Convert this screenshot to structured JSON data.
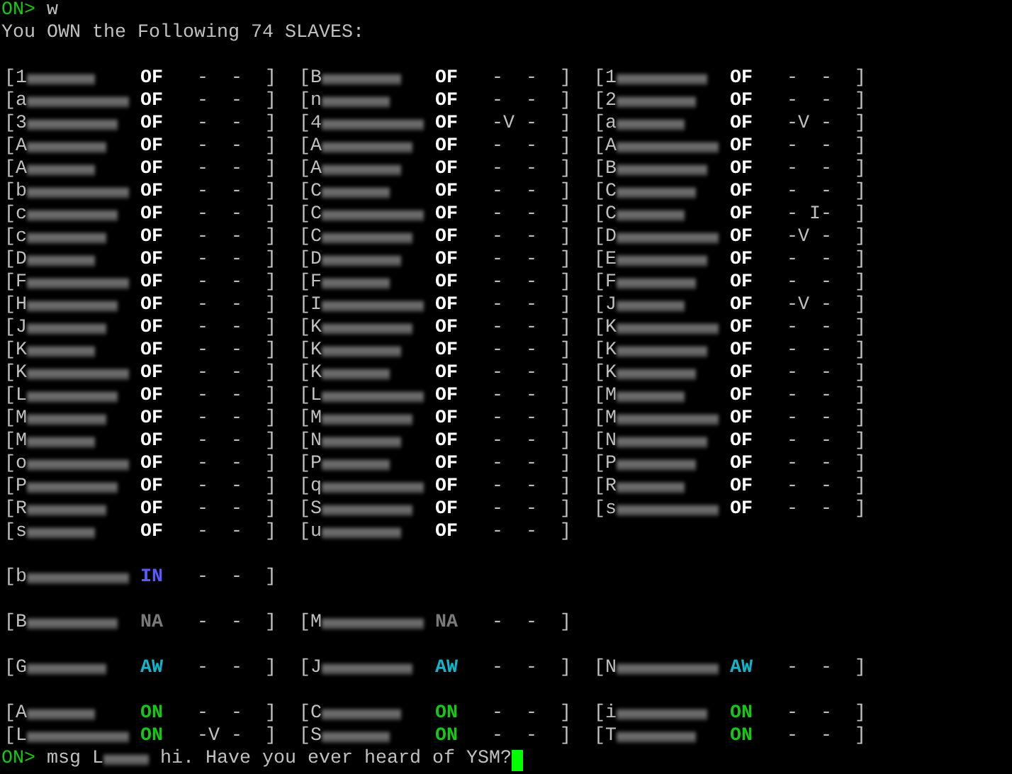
{
  "lines": [
    {
      "prompt": "ON>",
      "command": "w"
    },
    {
      "text": "You OWN the Following 74 SLAVES:"
    }
  ],
  "groups": [
    {
      "columns": [
        [
          {
            "name": "[1",
            "status": "OF",
            "color": "#ffffff",
            "tail": "-  -  ]"
          },
          {
            "name": "[a",
            "status": "OF",
            "color": "#ffffff",
            "tail": "-  -  ]"
          },
          {
            "name": "[3",
            "status": "OF",
            "color": "#ffffff",
            "tail": "-  -  ]"
          },
          {
            "name": "[A",
            "status": "OF",
            "color": "#ffffff",
            "tail": "-  -  ]"
          },
          {
            "name": "[A",
            "status": "OF",
            "color": "#ffffff",
            "tail": "-  -  ]"
          },
          {
            "name": "[b",
            "status": "OF",
            "color": "#ffffff",
            "tail": "-  -  ]"
          },
          {
            "name": "[c",
            "status": "OF",
            "color": "#ffffff",
            "tail": "-  -  ]"
          },
          {
            "name": "[c",
            "status": "OF",
            "color": "#ffffff",
            "tail": "-  -  ]"
          },
          {
            "name": "[D",
            "status": "OF",
            "color": "#ffffff",
            "tail": "-  -  ]"
          },
          {
            "name": "[F",
            "status": "OF",
            "color": "#ffffff",
            "tail": "-  -  ]"
          },
          {
            "name": "[H",
            "status": "OF",
            "color": "#ffffff",
            "tail": "-  -  ]"
          },
          {
            "name": "[J",
            "status": "OF",
            "color": "#ffffff",
            "tail": "-  -  ]"
          },
          {
            "name": "[K",
            "status": "OF",
            "color": "#ffffff",
            "tail": "-  -  ]"
          },
          {
            "name": "[K",
            "status": "OF",
            "color": "#ffffff",
            "tail": "-  -  ]"
          },
          {
            "name": "[L",
            "status": "OF",
            "color": "#ffffff",
            "tail": "-  -  ]"
          },
          {
            "name": "[M",
            "status": "OF",
            "color": "#ffffff",
            "tail": "-  -  ]"
          },
          {
            "name": "[M",
            "status": "OF",
            "color": "#ffffff",
            "tail": "-  -  ]"
          },
          {
            "name": "[o",
            "status": "OF",
            "color": "#ffffff",
            "tail": "-  -  ]"
          },
          {
            "name": "[P",
            "status": "OF",
            "color": "#ffffff",
            "tail": "-  -  ]"
          },
          {
            "name": "[R",
            "status": "OF",
            "color": "#ffffff",
            "tail": "-  -  ]"
          },
          {
            "name": "[s",
            "status": "OF",
            "color": "#ffffff",
            "tail": "-  -  ]"
          }
        ],
        [
          {
            "name": "[B",
            "status": "OF",
            "color": "#ffffff",
            "tail": "-  -  ]"
          },
          {
            "name": "[n",
            "status": "OF",
            "color": "#ffffff",
            "tail": "-  -  ]"
          },
          {
            "name": "[4",
            "status": "OF",
            "color": "#ffffff",
            "tail": "-V -  ]"
          },
          {
            "name": "[A",
            "status": "OF",
            "color": "#ffffff",
            "tail": "-  -  ]"
          },
          {
            "name": "[A",
            "status": "OF",
            "color": "#ffffff",
            "tail": "-  -  ]"
          },
          {
            "name": "[C",
            "status": "OF",
            "color": "#ffffff",
            "tail": "-  -  ]"
          },
          {
            "name": "[C",
            "status": "OF",
            "color": "#ffffff",
            "tail": "-  -  ]"
          },
          {
            "name": "[C",
            "status": "OF",
            "color": "#ffffff",
            "tail": "-  -  ]"
          },
          {
            "name": "[D",
            "status": "OF",
            "color": "#ffffff",
            "tail": "-  -  ]"
          },
          {
            "name": "[F",
            "status": "OF",
            "color": "#ffffff",
            "tail": "-  -  ]"
          },
          {
            "name": "[I",
            "status": "OF",
            "color": "#ffffff",
            "tail": "-  -  ]"
          },
          {
            "name": "[K",
            "status": "OF",
            "color": "#ffffff",
            "tail": "-  -  ]"
          },
          {
            "name": "[K",
            "status": "OF",
            "color": "#ffffff",
            "tail": "-  -  ]"
          },
          {
            "name": "[K",
            "status": "OF",
            "color": "#ffffff",
            "tail": "-  -  ]"
          },
          {
            "name": "[L",
            "status": "OF",
            "color": "#ffffff",
            "tail": "-  -  ]"
          },
          {
            "name": "[M",
            "status": "OF",
            "color": "#ffffff",
            "tail": "-  -  ]"
          },
          {
            "name": "[N",
            "status": "OF",
            "color": "#ffffff",
            "tail": "-  -  ]"
          },
          {
            "name": "[P",
            "status": "OF",
            "color": "#ffffff",
            "tail": "-  -  ]"
          },
          {
            "name": "[q",
            "status": "OF",
            "color": "#ffffff",
            "tail": "-  -  ]"
          },
          {
            "name": "[S",
            "status": "OF",
            "color": "#ffffff",
            "tail": "-  -  ]"
          },
          {
            "name": "[u",
            "status": "OF",
            "color": "#ffffff",
            "tail": "-  -  ]"
          }
        ],
        [
          {
            "name": "[1",
            "status": "OF",
            "color": "#ffffff",
            "tail": "-  -  ]"
          },
          {
            "name": "[2",
            "status": "OF",
            "color": "#ffffff",
            "tail": "-  -  ]"
          },
          {
            "name": "[a",
            "status": "OF",
            "color": "#ffffff",
            "tail": "-V -  ]"
          },
          {
            "name": "[A",
            "status": "OF",
            "color": "#ffffff",
            "tail": "-  -  ]"
          },
          {
            "name": "[B",
            "status": "OF",
            "color": "#ffffff",
            "tail": "-  -  ]"
          },
          {
            "name": "[C",
            "status": "OF",
            "color": "#ffffff",
            "tail": "-  -  ]"
          },
          {
            "name": "[C",
            "status": "OF",
            "color": "#ffffff",
            "tail": "- I-  ]"
          },
          {
            "name": "[D",
            "status": "OF",
            "color": "#ffffff",
            "tail": "-V -  ]"
          },
          {
            "name": "[E",
            "status": "OF",
            "color": "#ffffff",
            "tail": "-  -  ]"
          },
          {
            "name": "[F",
            "status": "OF",
            "color": "#ffffff",
            "tail": "-  -  ]"
          },
          {
            "name": "[J",
            "status": "OF",
            "color": "#ffffff",
            "tail": "-V -  ]"
          },
          {
            "name": "[K",
            "status": "OF",
            "color": "#ffffff",
            "tail": "-  -  ]"
          },
          {
            "name": "[K",
            "status": "OF",
            "color": "#ffffff",
            "tail": "-  -  ]"
          },
          {
            "name": "[K",
            "status": "OF",
            "color": "#ffffff",
            "tail": "-  -  ]"
          },
          {
            "name": "[M",
            "status": "OF",
            "color": "#ffffff",
            "tail": "-  -  ]"
          },
          {
            "name": "[M",
            "status": "OF",
            "color": "#ffffff",
            "tail": "-  -  ]"
          },
          {
            "name": "[N",
            "status": "OF",
            "color": "#ffffff",
            "tail": "-  -  ]"
          },
          {
            "name": "[P",
            "status": "OF",
            "color": "#ffffff",
            "tail": "-  -  ]"
          },
          {
            "name": "[R",
            "status": "OF",
            "color": "#ffffff",
            "tail": "-  -  ]"
          },
          {
            "name": "[s",
            "status": "OF",
            "color": "#ffffff",
            "tail": "-  -  ]"
          }
        ]
      ]
    },
    {
      "columns": [
        [
          {
            "name": "[b",
            "status": "IN",
            "color": "#5a5aff",
            "tail": "-  -  ]"
          }
        ]
      ]
    },
    {
      "columns": [
        [
          {
            "name": "[B",
            "status": "NA",
            "color": "#7a7a7a",
            "tail": "-  -  ]"
          }
        ],
        [
          {
            "name": "[M",
            "status": "NA",
            "color": "#7a7a7a",
            "tail": "-  -  ]"
          }
        ]
      ]
    },
    {
      "columns": [
        [
          {
            "name": "[G",
            "status": "AW",
            "color": "#14b4c8",
            "tail": "-  -  ]"
          }
        ],
        [
          {
            "name": "[J",
            "status": "AW",
            "color": "#14b4c8",
            "tail": "-  -  ]"
          }
        ],
        [
          {
            "name": "[N",
            "status": "AW",
            "color": "#14b4c8",
            "tail": "-  -  ]"
          }
        ]
      ]
    },
    {
      "columns": [
        [
          {
            "name": "[A",
            "status": "ON",
            "color": "#14c814",
            "tail": "-  -  ]"
          },
          {
            "name": "[L",
            "status": "ON",
            "color": "#14c814",
            "tail": "-V -  ]"
          }
        ],
        [
          {
            "name": "[C",
            "status": "ON",
            "color": "#14c814",
            "tail": "-  -  ]"
          },
          {
            "name": "[S",
            "status": "ON",
            "color": "#14c814",
            "tail": "-  -  ]"
          }
        ],
        [
          {
            "name": "[i",
            "status": "ON",
            "color": "#14c814",
            "tail": "-  -  ]"
          },
          {
            "name": "[T",
            "status": "ON",
            "color": "#14c814",
            "tail": "-  -  ]"
          }
        ]
      ]
    }
  ],
  "input": {
    "prompt": "ON>",
    "command": "msg L",
    "message": "hi. Have you ever heard of YSM?"
  }
}
